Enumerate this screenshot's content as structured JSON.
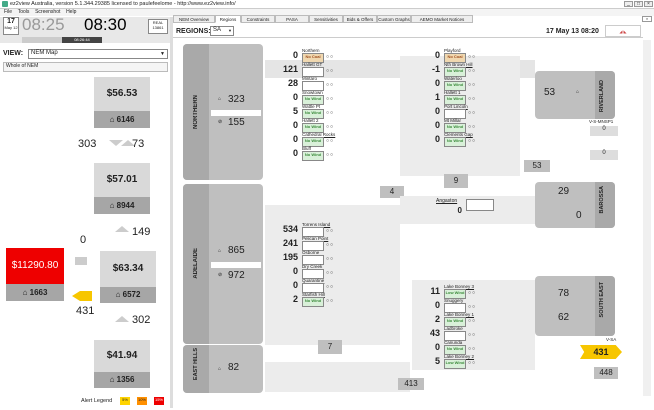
{
  "app": {
    "title": "ez2view Australia, version 5.1.344.29385 licensed to paulefeelome - http://www.ez2view.info/",
    "menu": [
      "File",
      "Tools",
      "Screenshot",
      "Help"
    ]
  },
  "clock": {
    "day": "17",
    "month": "May 12",
    "time_main": "08:25",
    "time_disp": "08:30",
    "real": "REAL",
    "real_sub": "13861",
    "row2a": "NEM Time",
    "row2b": "08:26:44"
  },
  "view": {
    "label": "VIEW:",
    "selected": "NEM Map",
    "sub": "Whole of NEM"
  },
  "tabs": [
    "NEM Overview",
    "Regions",
    "Constraints",
    "PASA",
    "Sensitivities",
    "Bids & Offers",
    "Custom Graphs",
    "AEMO Market Notices"
  ],
  "region_header": {
    "label": "REGIONS:",
    "selected": "SA",
    "datetime": "17 May 13 08:20"
  },
  "nem": {
    "qld": {
      "price": "$56.53",
      "demand": "6146"
    },
    "nsw": {
      "price": "$57.01",
      "demand": "8944"
    },
    "vic": {
      "price": "$63.34",
      "demand": "6572"
    },
    "sa": {
      "price": "$11290.80",
      "demand": "1663"
    },
    "tas": {
      "price": "$41.94",
      "demand": "1356"
    },
    "flows": {
      "qni_a": "303",
      "qni_b": "73",
      "vn": "149",
      "sa_link": "0",
      "heywood": "431",
      "basslink": "302"
    }
  },
  "alert": {
    "label": "Alert Legend",
    "levels": [
      "5%",
      "10%",
      "15%"
    ]
  },
  "sa": {
    "northern": {
      "label": "NORTHERN",
      "demand": "323",
      "gen": "155"
    },
    "adelaide": {
      "label": "ADELAIDE",
      "demand": "865",
      "gen": "972"
    },
    "easthills": {
      "label": "EAST HILLS",
      "demand": "82"
    },
    "riverland": {
      "label": "RIVERLAND",
      "demand": "53"
    },
    "barossa": {
      "label": "BAROSSA",
      "demand": "29",
      "gen": "0"
    },
    "southeast": {
      "label": "SOUTH EAST",
      "demand": "78",
      "gen": "62"
    },
    "flows": {
      "f53": "53",
      "f9": "9",
      "f4": "4",
      "f7": "7",
      "f413": "413",
      "f448": "448",
      "v_sa": "431",
      "vsmnsp": "V-S-MNSP1",
      "vsa": "V-SA",
      "mnsp_a": "0",
      "mnsp_b": "0"
    },
    "northern_units": [
      {
        "mw": "0",
        "name": "Northern",
        "status": "No Coal"
      },
      {
        "mw": "121",
        "name": "Hallett GT",
        "status": ""
      },
      {
        "mw": "28",
        "name": "Mintaro",
        "status": ""
      },
      {
        "mw": "0",
        "name": "Snowtown",
        "status": "No Wind"
      },
      {
        "mw": "5",
        "name": "Wattle Pt",
        "status": "No Wind"
      },
      {
        "mw": "0",
        "name": "Hallett 2",
        "status": "No Wind"
      },
      {
        "mw": "0",
        "name": "Cathedral Rocks",
        "status": "No Wind"
      },
      {
        "mw": "0",
        "name": "Bluff",
        "status": "No Wind"
      }
    ],
    "northern_units_r": [
      {
        "mw": "0",
        "name": "Playford",
        "status": "No Coal"
      },
      {
        "mw": "-1",
        "name": "Nth Brown Hill",
        "status": "No Wind"
      },
      {
        "mw": "0",
        "name": "Waterloo",
        "status": "No Wind"
      },
      {
        "mw": "1",
        "name": "Hallett 1",
        "status": "No Wind"
      },
      {
        "mw": "0",
        "name": "Port Lincoln",
        "status": ""
      },
      {
        "mw": "0",
        "name": "Mt Millar",
        "status": "No Wind"
      },
      {
        "mw": "0",
        "name": "Clements Gap",
        "status": "No Wind"
      }
    ],
    "adelaide_units": [
      {
        "mw": "534",
        "name": "Torrens Island"
      },
      {
        "mw": "241",
        "name": "Pelican Point"
      },
      {
        "mw": "195",
        "name": "Osborne"
      },
      {
        "mw": "0",
        "name": "Dry Creek"
      },
      {
        "mw": "0",
        "name": "Quarantine"
      },
      {
        "mw": "2",
        "name": "Starfish Hill",
        "status": "No Wind"
      }
    ],
    "barossa_units": [
      {
        "mw": "0",
        "name": "Angaston"
      }
    ],
    "se_units": [
      {
        "mw": "11",
        "name": "Lake Bonney 3",
        "status": "Low Wind"
      },
      {
        "mw": "0",
        "name": "Snuggery",
        "status": ""
      },
      {
        "mw": "2",
        "name": "Lake Bonney 1",
        "status": "No Wind"
      },
      {
        "mw": "43",
        "name": "Ladbroke",
        "status": ""
      },
      {
        "mw": "0",
        "name": "Canunda",
        "status": "No Wind"
      },
      {
        "mw": "5",
        "name": "Lake Bonney 2",
        "status": "Low Wind"
      }
    ]
  }
}
